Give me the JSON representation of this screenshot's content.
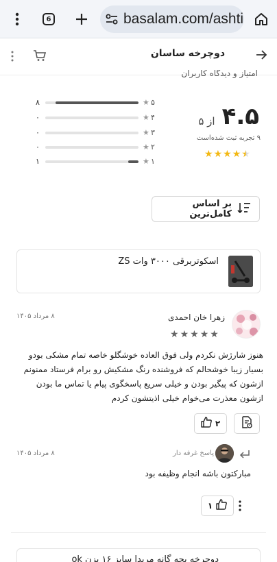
{
  "browser": {
    "url": "basalam.com/ashti",
    "tab_count": "6",
    "icons": [
      "more-vert-icon",
      "tab-switcher-icon",
      "new-tab-icon",
      "site-settings-icon",
      "home-icon"
    ]
  },
  "header": {
    "title": "دوچرخه ساسان",
    "icons": [
      "back-arrow-icon",
      "cart-icon",
      "more-icon"
    ]
  },
  "clipped_heading": "امتیاز و دیدگاه کاربران",
  "rating": {
    "score": "۴.۵",
    "out_of": "از ۵",
    "count_text": "۹ تجربه ثبت شده‌است",
    "stars_value": 4.5,
    "star_color": "#f3b813",
    "distribution": [
      {
        "star": "۵",
        "count": "۸",
        "fraction": 0.89
      },
      {
        "star": "۴",
        "count": "۰",
        "fraction": 0
      },
      {
        "star": "۳",
        "count": "۰",
        "fraction": 0
      },
      {
        "star": "۲",
        "count": "۰",
        "fraction": 0
      },
      {
        "star": "۱",
        "count": "۱",
        "fraction": 0.11
      }
    ]
  },
  "sort": {
    "label": "بر اساس کامل‌ترین",
    "icon": "sort-icon"
  },
  "product": {
    "name": "اسکوتربرقی ۳۰۰۰ وات ZS"
  },
  "review": {
    "author": "زهرا خان احمدی",
    "date": "۸ مرداد ۱۴۰۵",
    "stars_value": 5,
    "text": "هنوز شارژش نکردم ولی فوق العاده خوشگلو خاصه تمام مشکی بودو بسیار زیبا خوشحالم که فروشنده رنگ مشکیش رو برام فرستاد ممنونم ازشون که پیگیر بودن و خیلی سریع پاسخگوی پیام یا تماس ما بودن ازشون معذرت می‌خوام خیلی اذیتشون کردم",
    "likes": "۲",
    "icons": [
      "like-icon",
      "report-icon"
    ]
  },
  "reply": {
    "label": "پاسخ غرفه دار",
    "date": "۸ مرداد ۱۴۰۵",
    "text": "مبارکتون باشه انجام وظیفه بود",
    "likes": "۱",
    "icons": [
      "reply-arrow-icon",
      "like-icon",
      "more-icon"
    ]
  },
  "next_product": {
    "name": "دوچرخه بچه گانه مریدا سایز ۱۶ بزن ok"
  }
}
